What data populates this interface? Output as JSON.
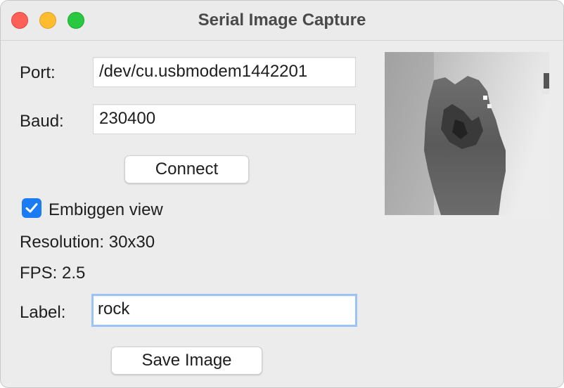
{
  "window": {
    "title": "Serial Image Capture"
  },
  "form": {
    "port_label": "Port:",
    "port_value": "/dev/cu.usbmodem1442201",
    "baud_label": "Baud:",
    "baud_value": "230400",
    "connect_label": "Connect",
    "embiggen_label": "Embiggen view",
    "embiggen_checked": true,
    "resolution_text": "Resolution: 30x30",
    "fps_text": "FPS: 2.5",
    "label_label": "Label:",
    "label_value": "rock",
    "save_label": "Save Image"
  },
  "colors": {
    "accent": "#1a7cf5",
    "focus_ring": "#9cc3f5"
  },
  "icons": {
    "close": "close-icon",
    "minimize": "minimize-icon",
    "maximize": "maximize-icon",
    "check": "checkmark-icon"
  }
}
